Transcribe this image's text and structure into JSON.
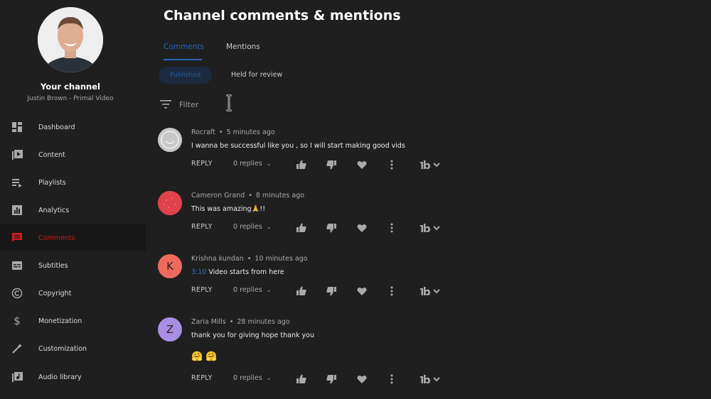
{
  "channel": {
    "title": "Your channel",
    "subtitle": "Justin Brown - Primal Video"
  },
  "nav": [
    {
      "label": "Dashboard",
      "icon": "dashboard-icon"
    },
    {
      "label": "Content",
      "icon": "content-icon"
    },
    {
      "label": "Playlists",
      "icon": "playlists-icon"
    },
    {
      "label": "Analytics",
      "icon": "analytics-icon"
    },
    {
      "label": "Comments",
      "icon": "comments-icon",
      "active": true
    },
    {
      "label": "Subtitles",
      "icon": "subtitles-icon"
    },
    {
      "label": "Copyright",
      "icon": "copyright-icon"
    },
    {
      "label": "Monetization",
      "icon": "dollar-icon"
    },
    {
      "label": "Customization",
      "icon": "magic-wand-icon"
    },
    {
      "label": "Audio library",
      "icon": "audio-library-icon"
    }
  ],
  "page": {
    "title": "Channel comments & mentions",
    "tabs": [
      "Comments",
      "Mentions"
    ],
    "chips": [
      "Published",
      "Held for review"
    ],
    "filter_placeholder": "Filter"
  },
  "actions": {
    "reply": "REPLY"
  },
  "comments": [
    {
      "author": "Rocraft",
      "time": "5 minutes ago",
      "text": "I wanna be successful like you , so I will start making good vids",
      "replies": "0 replies",
      "avatar_color": "#b5b5b5"
    },
    {
      "author": "Cameron Grand",
      "time": "8 minutes ago",
      "text": "This was amazing🙏!!",
      "replies": "0 replies",
      "avatar_color": "#e0424b"
    },
    {
      "author": "Krishna kundan",
      "time": "10 minutes ago",
      "timestamp_link": "3:10",
      "text": "Video starts from here",
      "replies": "0 replies",
      "avatar_letter": "K",
      "avatar_color": "#ef6a5e"
    },
    {
      "author": "Zaria Mills",
      "time": "28 minutes ago",
      "text": "thank you for giving hope thank you",
      "emoji": "🤗 🤗",
      "replies": "0 replies",
      "avatar_letter": "Z",
      "avatar_color": "#a98ee6"
    }
  ],
  "colors": {
    "accent_blue": "#2a66b8",
    "active_red": "#cc1b1b",
    "background": "#1f1f1f"
  }
}
